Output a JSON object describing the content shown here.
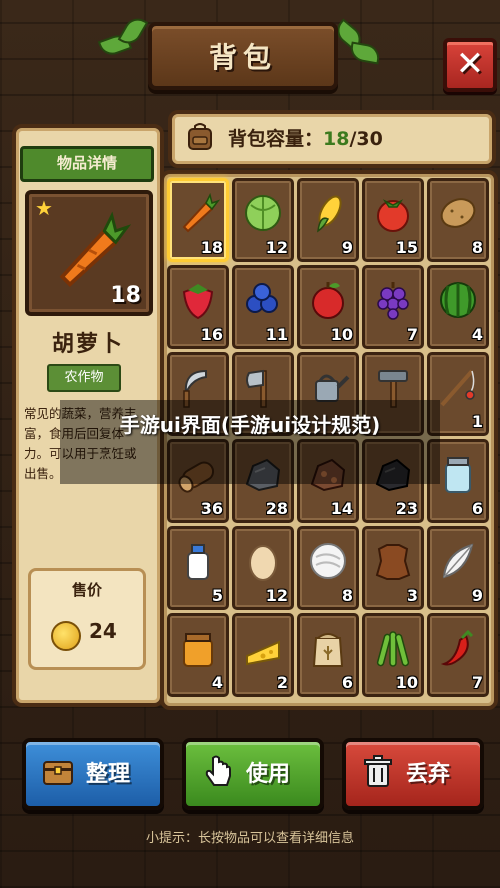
{
  "header": {
    "title": "背包",
    "close_label": "✕"
  },
  "details": {
    "section_title": "物品详情",
    "selected_count": "18",
    "item_name": "胡萝卜",
    "category": "农作物",
    "description": "常见的蔬菜，营养丰富，食用后回复体力。可以用于烹饪或出售。",
    "price_label": "售价",
    "price_value": "24"
  },
  "capacity": {
    "label": "背包容量：",
    "current": "18",
    "total": "/30"
  },
  "inventory": [
    {
      "name": "carrot",
      "count": "18",
      "selected": true
    },
    {
      "name": "cabbage",
      "count": "12"
    },
    {
      "name": "corn",
      "count": "9"
    },
    {
      "name": "tomato",
      "count": "15"
    },
    {
      "name": "potato",
      "count": "8"
    },
    {
      "name": "strawberry",
      "count": "16"
    },
    {
      "name": "blueberry",
      "count": "11"
    },
    {
      "name": "apple",
      "count": "10"
    },
    {
      "name": "grape",
      "count": "7"
    },
    {
      "name": "watermelon",
      "count": "4"
    },
    {
      "name": "sickle",
      "count": ""
    },
    {
      "name": "axe",
      "count": ""
    },
    {
      "name": "watering-can",
      "count": ""
    },
    {
      "name": "hammer",
      "count": ""
    },
    {
      "name": "fishing-rod",
      "count": "1"
    },
    {
      "name": "wood",
      "count": "36"
    },
    {
      "name": "stone",
      "count": "28"
    },
    {
      "name": "copper-ore",
      "count": "14"
    },
    {
      "name": "coal",
      "count": "23"
    },
    {
      "name": "glass-jar",
      "count": "6"
    },
    {
      "name": "milk",
      "count": "5"
    },
    {
      "name": "egg",
      "count": "12"
    },
    {
      "name": "wool",
      "count": "8"
    },
    {
      "name": "leather",
      "count": "3"
    },
    {
      "name": "feather",
      "count": "9"
    },
    {
      "name": "honey",
      "count": "4"
    },
    {
      "name": "cheese",
      "count": "2"
    },
    {
      "name": "flour",
      "count": "6"
    },
    {
      "name": "asparagus",
      "count": "10"
    },
    {
      "name": "chili-pepper",
      "count": "7"
    }
  ],
  "buttons": {
    "sort": "整理",
    "use": "使用",
    "drop": "丢弃"
  },
  "hint": "小提示：长按物品可以查看详细信息",
  "overlay": {
    "text": "手游ui界面(手游ui设计规范)"
  }
}
